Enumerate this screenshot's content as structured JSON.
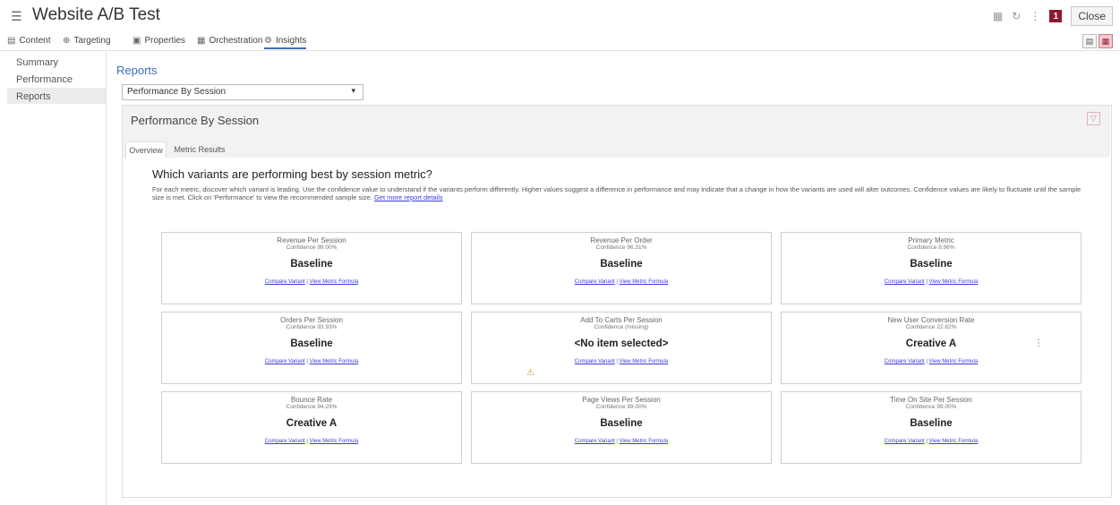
{
  "header": {
    "title": "Website A/B Test",
    "badge": "1",
    "close_label": "Close"
  },
  "tabs": [
    {
      "label": "Content",
      "icon": "document-icon"
    },
    {
      "label": "Targeting",
      "icon": "target-icon"
    },
    {
      "label": "Properties",
      "icon": "properties-icon"
    },
    {
      "label": "Orchestration",
      "icon": "calendar-icon"
    },
    {
      "label": "Insights",
      "icon": "insights-icon",
      "active": true
    }
  ],
  "sidebar": {
    "items": [
      {
        "label": "Summary"
      },
      {
        "label": "Performance"
      },
      {
        "label": "Reports",
        "selected": true
      }
    ]
  },
  "main": {
    "title": "Reports",
    "report_select": "Performance By Session",
    "panel_title": "Performance By Session",
    "subtabs": [
      {
        "label": "Overview",
        "active": true
      },
      {
        "label": "Metric Results"
      }
    ],
    "question": "Which variants are performing best by session metric?",
    "description": "For each metric, discover which variant is leading. Use the confidence value to understand if the variants perform differently. Higher values suggest a difference in performance and may indicate that a change in how the variants are used will alter outcomes. Confidence values are likely to fluctuate until the sample size is met. Click on 'Performance' to view the recommended sample size. ",
    "details_link": "Get more report details"
  },
  "link_labels": {
    "compare": "Compare Variant",
    "sep": " | ",
    "formula": "View Metric Formula"
  },
  "cards": [
    {
      "title": "Revenue Per Session",
      "confidence": "Confidence 99.00%",
      "value": "Baseline"
    },
    {
      "title": "Revenue Per Order",
      "confidence": "Confidence 96.31%",
      "value": "Baseline"
    },
    {
      "title": "Primary Metric",
      "confidence": "Confidence 8.96%",
      "value": "Baseline"
    },
    {
      "title": "Orders Per Session",
      "confidence": "Confidence 93.93%",
      "value": "Baseline"
    },
    {
      "title": "Add To Carts Per Session",
      "confidence": "Confidence (missing)",
      "value": "<No item selected>"
    },
    {
      "title": "New User Conversion Rate",
      "confidence": "Confidence 22.82%",
      "value": "Creative A"
    },
    {
      "title": "Bounce Rate",
      "confidence": "Confidence 94.29%",
      "value": "Creative A"
    },
    {
      "title": "Page Views Per Session",
      "confidence": "Confidence 99.00%",
      "value": "Baseline"
    },
    {
      "title": "Time On Site Per Session",
      "confidence": "Confidence 99.00%",
      "value": "Baseline"
    }
  ],
  "colors": {
    "accent": "#3b6fb6",
    "badge": "#8b1a2c",
    "link": "#3b3bd6",
    "warning": "#c79a2a"
  }
}
